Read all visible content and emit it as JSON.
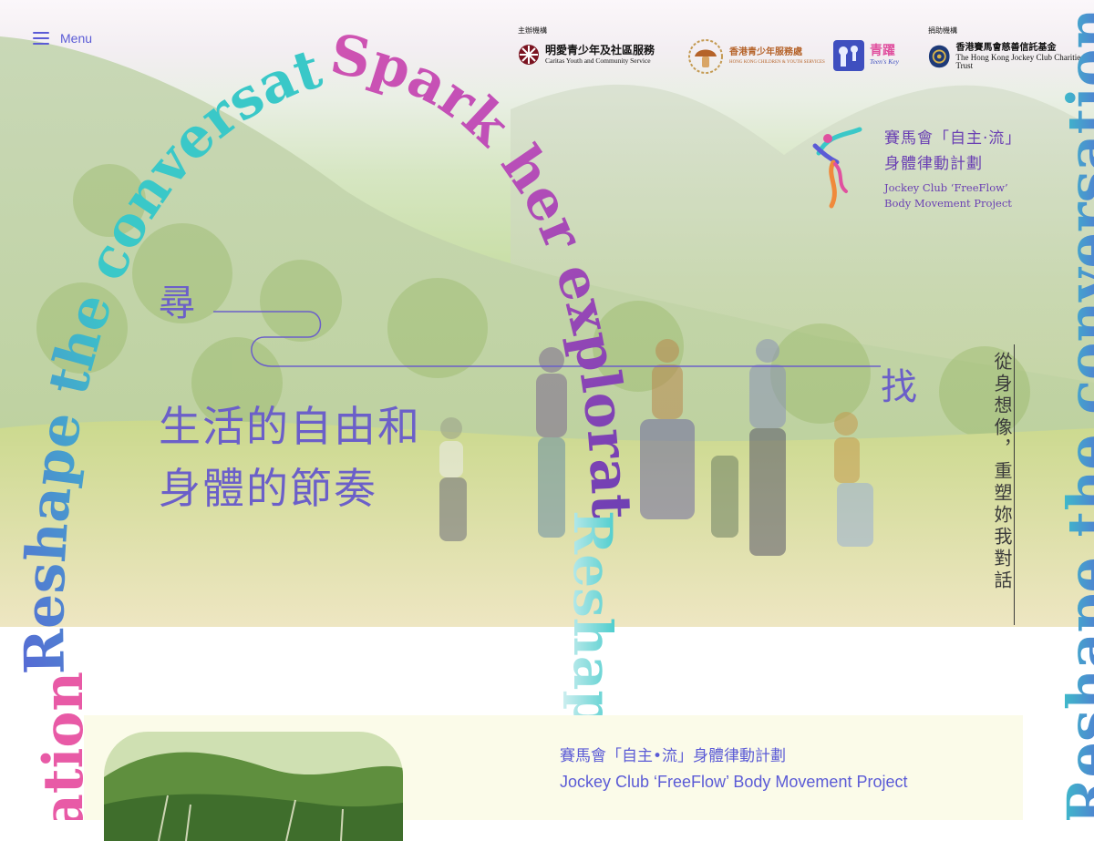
{
  "menu": {
    "label": "Menu",
    "icon": "hamburger-icon"
  },
  "header": {
    "organizer_label": "主辦機構",
    "sponsor_label": "捐助機構",
    "organizers": [
      {
        "cn": "明愛青少年及社區服務",
        "en": "Caritas Youth and Community Service"
      },
      {
        "cn": "香港青少年服務處",
        "en": "HONG KONG CHILDREN & YOUTH SERVICES"
      },
      {
        "cn": "青躍",
        "en": "Teen's Key"
      }
    ],
    "sponsor": {
      "cn": "香港賽馬會慈善信託基金",
      "en": "The Hong Kong Jockey Club Charities Trust"
    }
  },
  "project": {
    "name_cn_line1": "賽馬會「自主·流」",
    "name_cn_line2": "身體律動計劃",
    "name_en_line1": "Jockey Club ‘FreeFlow’",
    "name_en_line2": "Body Movement Project"
  },
  "hero": {
    "char_seek": "尋",
    "char_find": "找",
    "line1": "生活的自由和",
    "line2": "身體的節奏",
    "tagline": "從身想像，重塑妳我對話",
    "arc_text_1": "Reshape the conversation",
    "arc_text_2": "Spark her exploration",
    "arc_text_3": "Reshape",
    "arc_text_left_bottom": "ation",
    "right_vertical": "Reshape the conversation"
  },
  "section": {
    "title_cn": "賽馬會「自主•流」身體律動計劃",
    "title_en": "Jockey Club ‘FreeFlow’ Body Movement Project"
  },
  "colors": {
    "accent": "#5b5bd6",
    "pink": "#e0519f",
    "teal": "#3ac8c8",
    "purple": "#6a3fb3"
  }
}
